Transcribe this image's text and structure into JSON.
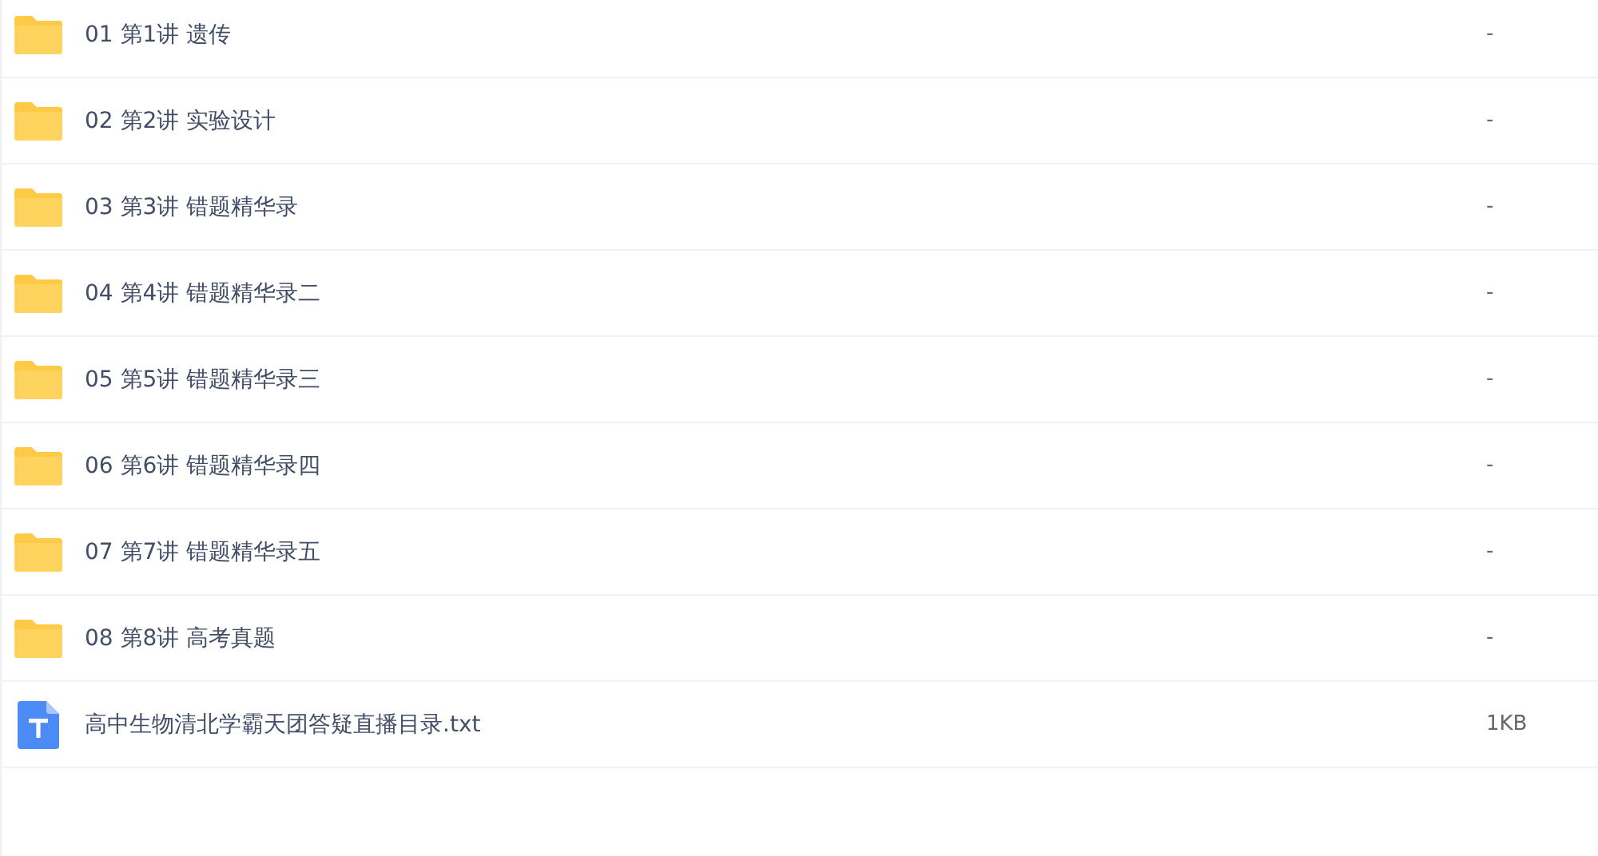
{
  "files": [
    {
      "kind": "folder",
      "name": "01 第1讲 遗传",
      "size": "-"
    },
    {
      "kind": "folder",
      "name": "02 第2讲 实验设计",
      "size": "-"
    },
    {
      "kind": "folder",
      "name": "03 第3讲 错题精华录",
      "size": "-"
    },
    {
      "kind": "folder",
      "name": "04 第4讲 错题精华录二",
      "size": "-"
    },
    {
      "kind": "folder",
      "name": "05 第5讲 错题精华录三",
      "size": "-"
    },
    {
      "kind": "folder",
      "name": "06 第6讲 错题精华录四",
      "size": "-"
    },
    {
      "kind": "folder",
      "name": "07 第7讲 错题精华录五",
      "size": "-"
    },
    {
      "kind": "folder",
      "name": "08 第8讲 高考真题",
      "size": "-"
    },
    {
      "kind": "text",
      "name": "高中生物清北学霸天团答疑直播目录.txt",
      "size": "1KB"
    }
  ]
}
